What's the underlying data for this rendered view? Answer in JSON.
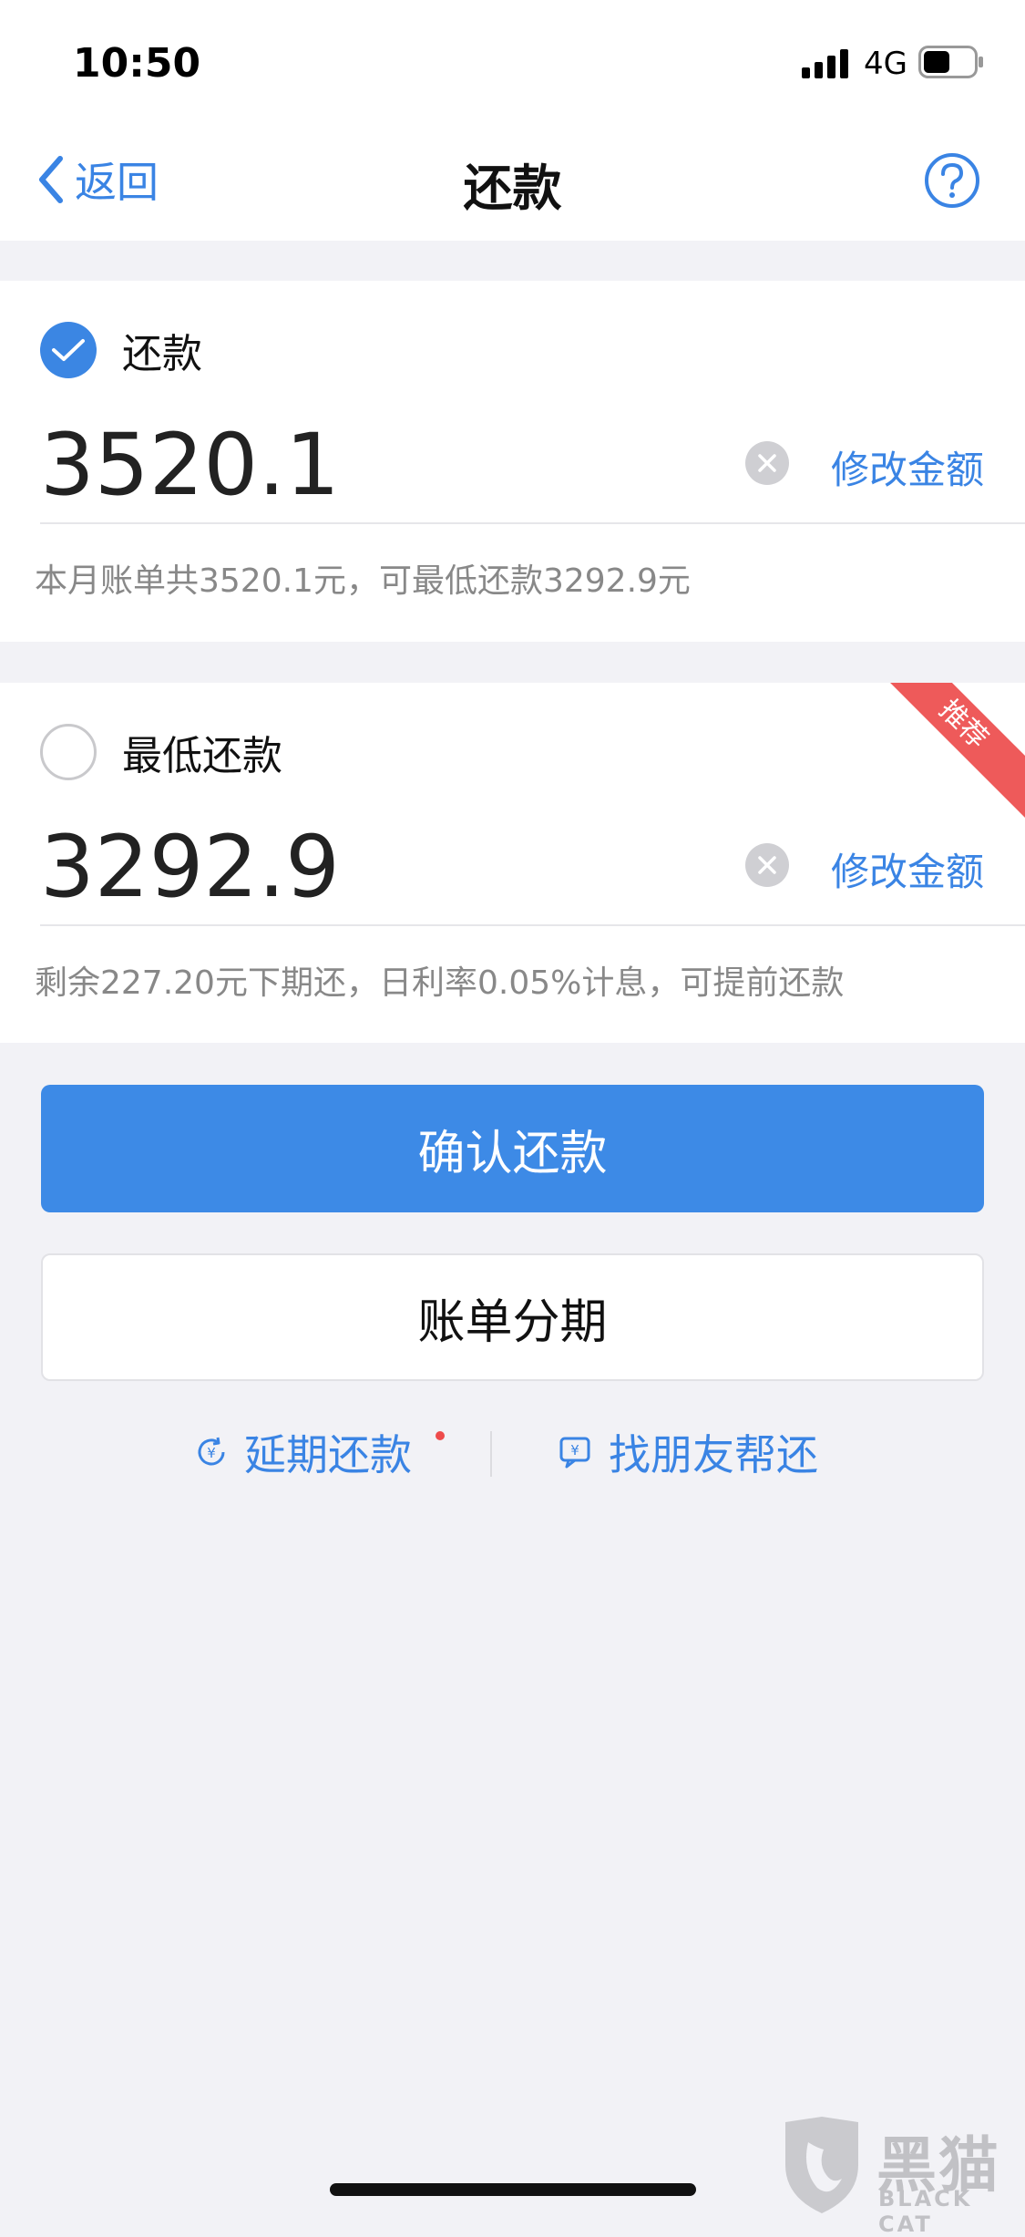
{
  "status_bar": {
    "time": "10:50",
    "network": "4G"
  },
  "nav": {
    "back_label": "返回",
    "title": "还款"
  },
  "options": [
    {
      "label": "还款",
      "amount": "3520.1",
      "edit_label": "修改金额",
      "note": "本月账单共3520.1元，可最低还款3292.9元",
      "selected": true
    },
    {
      "label": "最低还款",
      "amount": "3292.9",
      "edit_label": "修改金额",
      "note": "剩余227.20元下期还，日利率0.05%计息，可提前还款",
      "selected": false,
      "badge": "推荐"
    }
  ],
  "actions": {
    "confirm_label": "确认还款",
    "installment_label": "账单分期"
  },
  "links": {
    "defer_label": "延期还款",
    "friend_label": "找朋友帮还"
  },
  "watermark": {
    "brand_cn": "黑猫",
    "brand_en": "BLACK CAT"
  },
  "colors": {
    "accent": "#3a84e4",
    "badge": "#ee5a5a",
    "background": "#f2f2f6"
  }
}
